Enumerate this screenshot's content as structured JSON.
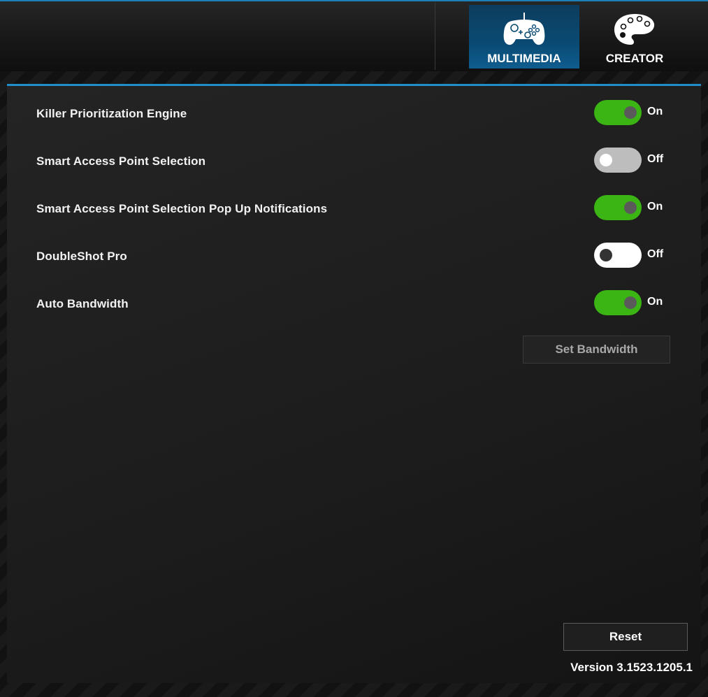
{
  "header": {
    "tabs": [
      {
        "label": "MULTIMEDIA",
        "icon": "gamepad-icon",
        "active": true
      },
      {
        "label": "CREATOR",
        "icon": "palette-icon",
        "active": false
      }
    ]
  },
  "settings": [
    {
      "label": "Killer Prioritization Engine",
      "state": "On"
    },
    {
      "label": "Smart Access Point Selection",
      "state": "Off"
    },
    {
      "label": "Smart Access Point Selection Pop Up Notifications",
      "state": "On"
    },
    {
      "label": "DoubleShot Pro",
      "state": "Off"
    },
    {
      "label": "Auto Bandwidth",
      "state": "On"
    }
  ],
  "buttons": {
    "set_bandwidth": "Set Bandwidth",
    "reset": "Reset"
  },
  "footer": {
    "version": "Version 3.1523.1205.1"
  },
  "colors": {
    "accent": "#1f8ec9",
    "toggle_on": "#3ab514",
    "toggle_off": "#bdbdbd"
  }
}
